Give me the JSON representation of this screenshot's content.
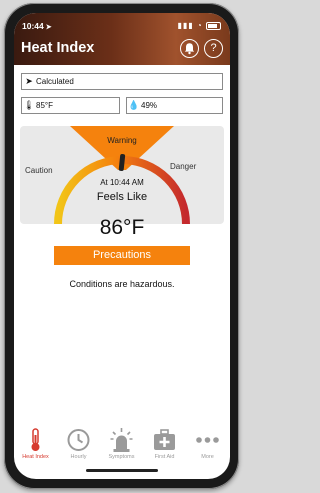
{
  "status": {
    "time": "10:44"
  },
  "header": {
    "title": "Heat Index",
    "bell_icon": "bell-icon",
    "help_label": "?"
  },
  "inputs": {
    "location": "Calculated",
    "temperature": "85°F",
    "humidity": "49%"
  },
  "gauge": {
    "left_label": "Caution",
    "center_label": "Warning",
    "right_label": "Danger",
    "reading_time": "At 10:44 AM",
    "feels_like_label": "Feels Like",
    "colors": {
      "warning": "#f5820d",
      "caution": "#f2c518",
      "danger": "#c4282d"
    }
  },
  "result": {
    "value": "86°F",
    "precautions_label": "Precautions",
    "message": "Conditions are hazardous."
  },
  "tabs": [
    {
      "label": "Heat Index",
      "icon": "thermometer-icon",
      "active": true
    },
    {
      "label": "Hourly",
      "icon": "clock-icon",
      "active": false
    },
    {
      "label": "Symptoms",
      "icon": "siren-icon",
      "active": false
    },
    {
      "label": "First Aid",
      "icon": "first-aid-kit-icon",
      "active": false
    },
    {
      "label": "More",
      "icon": "more-icon",
      "active": false
    }
  ]
}
